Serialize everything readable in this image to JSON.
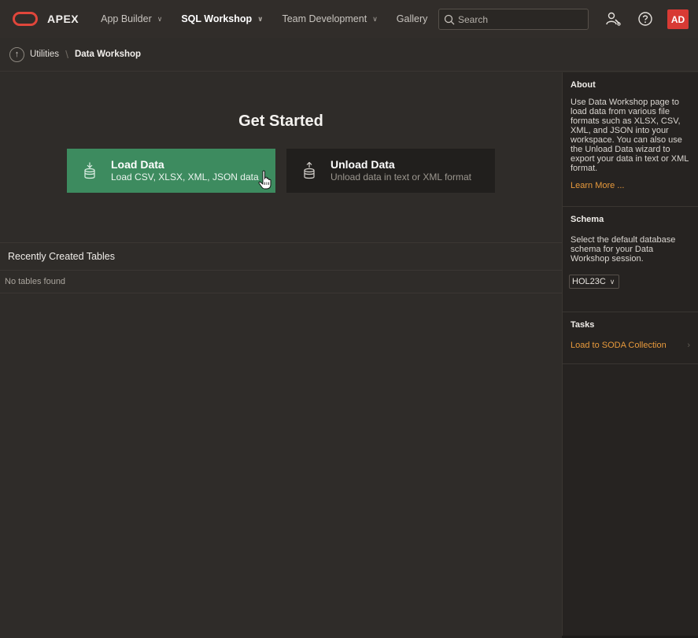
{
  "app": {
    "name": "APEX"
  },
  "nav": {
    "items": [
      {
        "label": "App Builder",
        "has_menu": true
      },
      {
        "label": "SQL Workshop",
        "has_menu": true,
        "active": true
      },
      {
        "label": "Team Development",
        "has_menu": true
      },
      {
        "label": "Gallery",
        "has_menu": false
      }
    ],
    "search_placeholder": "Search",
    "avatar": "AD"
  },
  "breadcrumb": {
    "parent": "Utilities",
    "current": "Data Workshop"
  },
  "main": {
    "heading": "Get Started",
    "cards": {
      "load": {
        "title": "Load Data",
        "subtitle": "Load CSV, XLSX, XML, JSON data"
      },
      "unload": {
        "title": "Unload Data",
        "subtitle": "Unload data in text or XML format"
      }
    },
    "recent": {
      "title": "Recently Created Tables",
      "empty": "No tables found"
    }
  },
  "side": {
    "about": {
      "title": "About",
      "text": "Use Data Workshop page to load data from various file formats such as XLSX, CSV, XML, and JSON into your workspace. You can also use the Unload Data wizard to export your data in text or XML format.",
      "link": "Learn More ..."
    },
    "schema": {
      "title": "Schema",
      "text": "Select the default database schema for your Data Workshop session.",
      "value": "HOL23C"
    },
    "tasks": {
      "title": "Tasks",
      "items": [
        "Load to SODA Collection"
      ]
    }
  },
  "colors": {
    "brand_red": "#e0463b",
    "load_card": "#3d8b5f",
    "link_orange": "#e89a3c",
    "avatar_bg": "#d83a34"
  }
}
